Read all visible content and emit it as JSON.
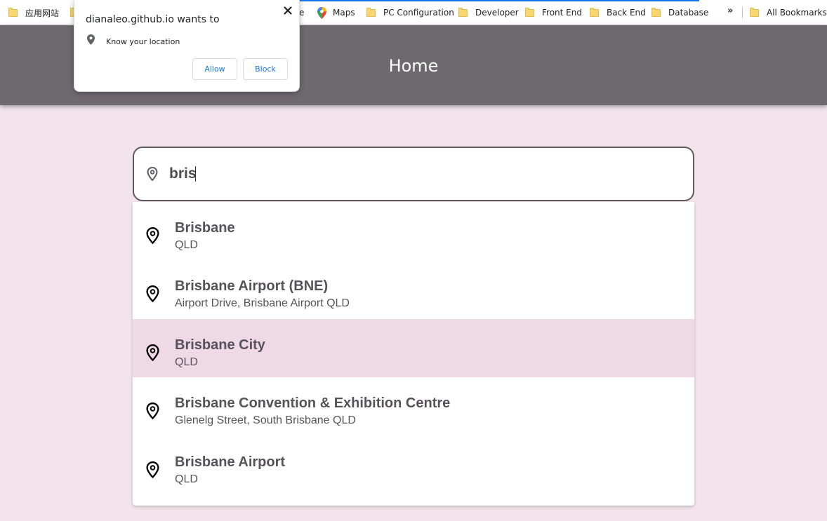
{
  "bookmarks": {
    "items": [
      {
        "label": "应用网站",
        "icon": "folder-icon"
      },
      {
        "label": "e",
        "icon": "folder-icon"
      },
      {
        "label": "Maps",
        "icon": "maps-icon"
      },
      {
        "label": "PC Configuration",
        "icon": "folder-icon"
      },
      {
        "label": "Developer",
        "icon": "folder-icon"
      },
      {
        "label": "Front End",
        "icon": "folder-icon"
      },
      {
        "label": "Back End",
        "icon": "folder-icon"
      },
      {
        "label": "Database",
        "icon": "folder-icon"
      }
    ],
    "overflow_label": "»",
    "all_bookmarks_label": "All Bookmarks"
  },
  "permission_popup": {
    "title": "dianaleo.github.io wants to",
    "request": "Know your location",
    "allow_label": "Allow",
    "block_label": "Block"
  },
  "header": {
    "title": "Home",
    "background": "#6e696f"
  },
  "search": {
    "value": "bris"
  },
  "suggestions": [
    {
      "main": "Brisbane",
      "sub": "QLD",
      "active": false
    },
    {
      "main": "Brisbane Airport (BNE)",
      "sub": "Airport Drive, Brisbane Airport QLD",
      "active": false
    },
    {
      "main": "Brisbane City",
      "sub": "QLD",
      "active": true
    },
    {
      "main": "Brisbane Convention & Exhibition Centre",
      "sub": "Glenelg Street, South Brisbane QLD",
      "active": false
    },
    {
      "main": "Brisbane Airport",
      "sub": "QLD",
      "active": false
    }
  ],
  "colors": {
    "page_background": "#f3e4ec",
    "active_row": "#eed9e5",
    "text": "#57525a",
    "link_blue": "#1a73e8"
  }
}
